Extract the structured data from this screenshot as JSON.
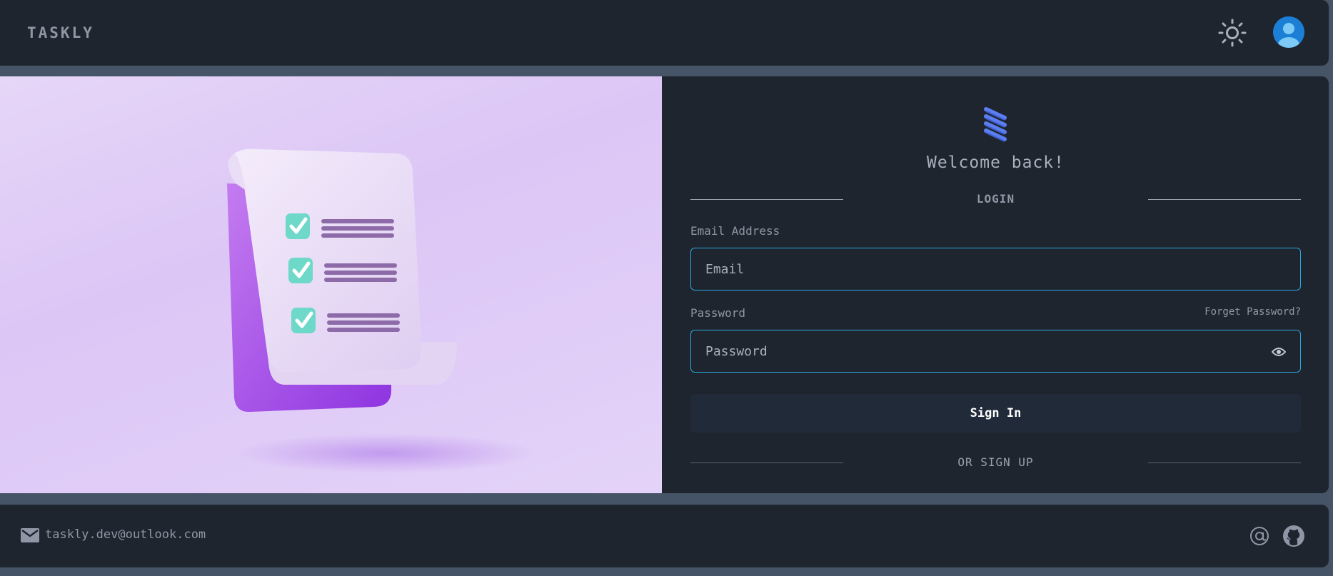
{
  "header": {
    "brand": "TASKLY",
    "theme_icon": "sun-icon",
    "avatar_icon": "user-avatar-icon"
  },
  "login": {
    "logo_icon": "taskly-logo-icon",
    "welcome": "Welcome back!",
    "section_title": "LOGIN",
    "email_label": "Email Address",
    "email_placeholder": "Email",
    "password_label": "Password",
    "forgot_link": "Forget Password?",
    "password_placeholder": "Password",
    "password_toggle_icon": "eye-icon",
    "sign_in_label": "Sign In",
    "signup_text": "OR SIGN UP"
  },
  "footer": {
    "email_icon": "mail-icon",
    "email": "tasklу.dev@outlook.com",
    "at_icon": "at-icon",
    "github_icon": "github-icon"
  },
  "colors": {
    "accent": "#2aa7e0",
    "panel": "#1f252e",
    "background": "#465467",
    "logo": "#5b7df0"
  }
}
